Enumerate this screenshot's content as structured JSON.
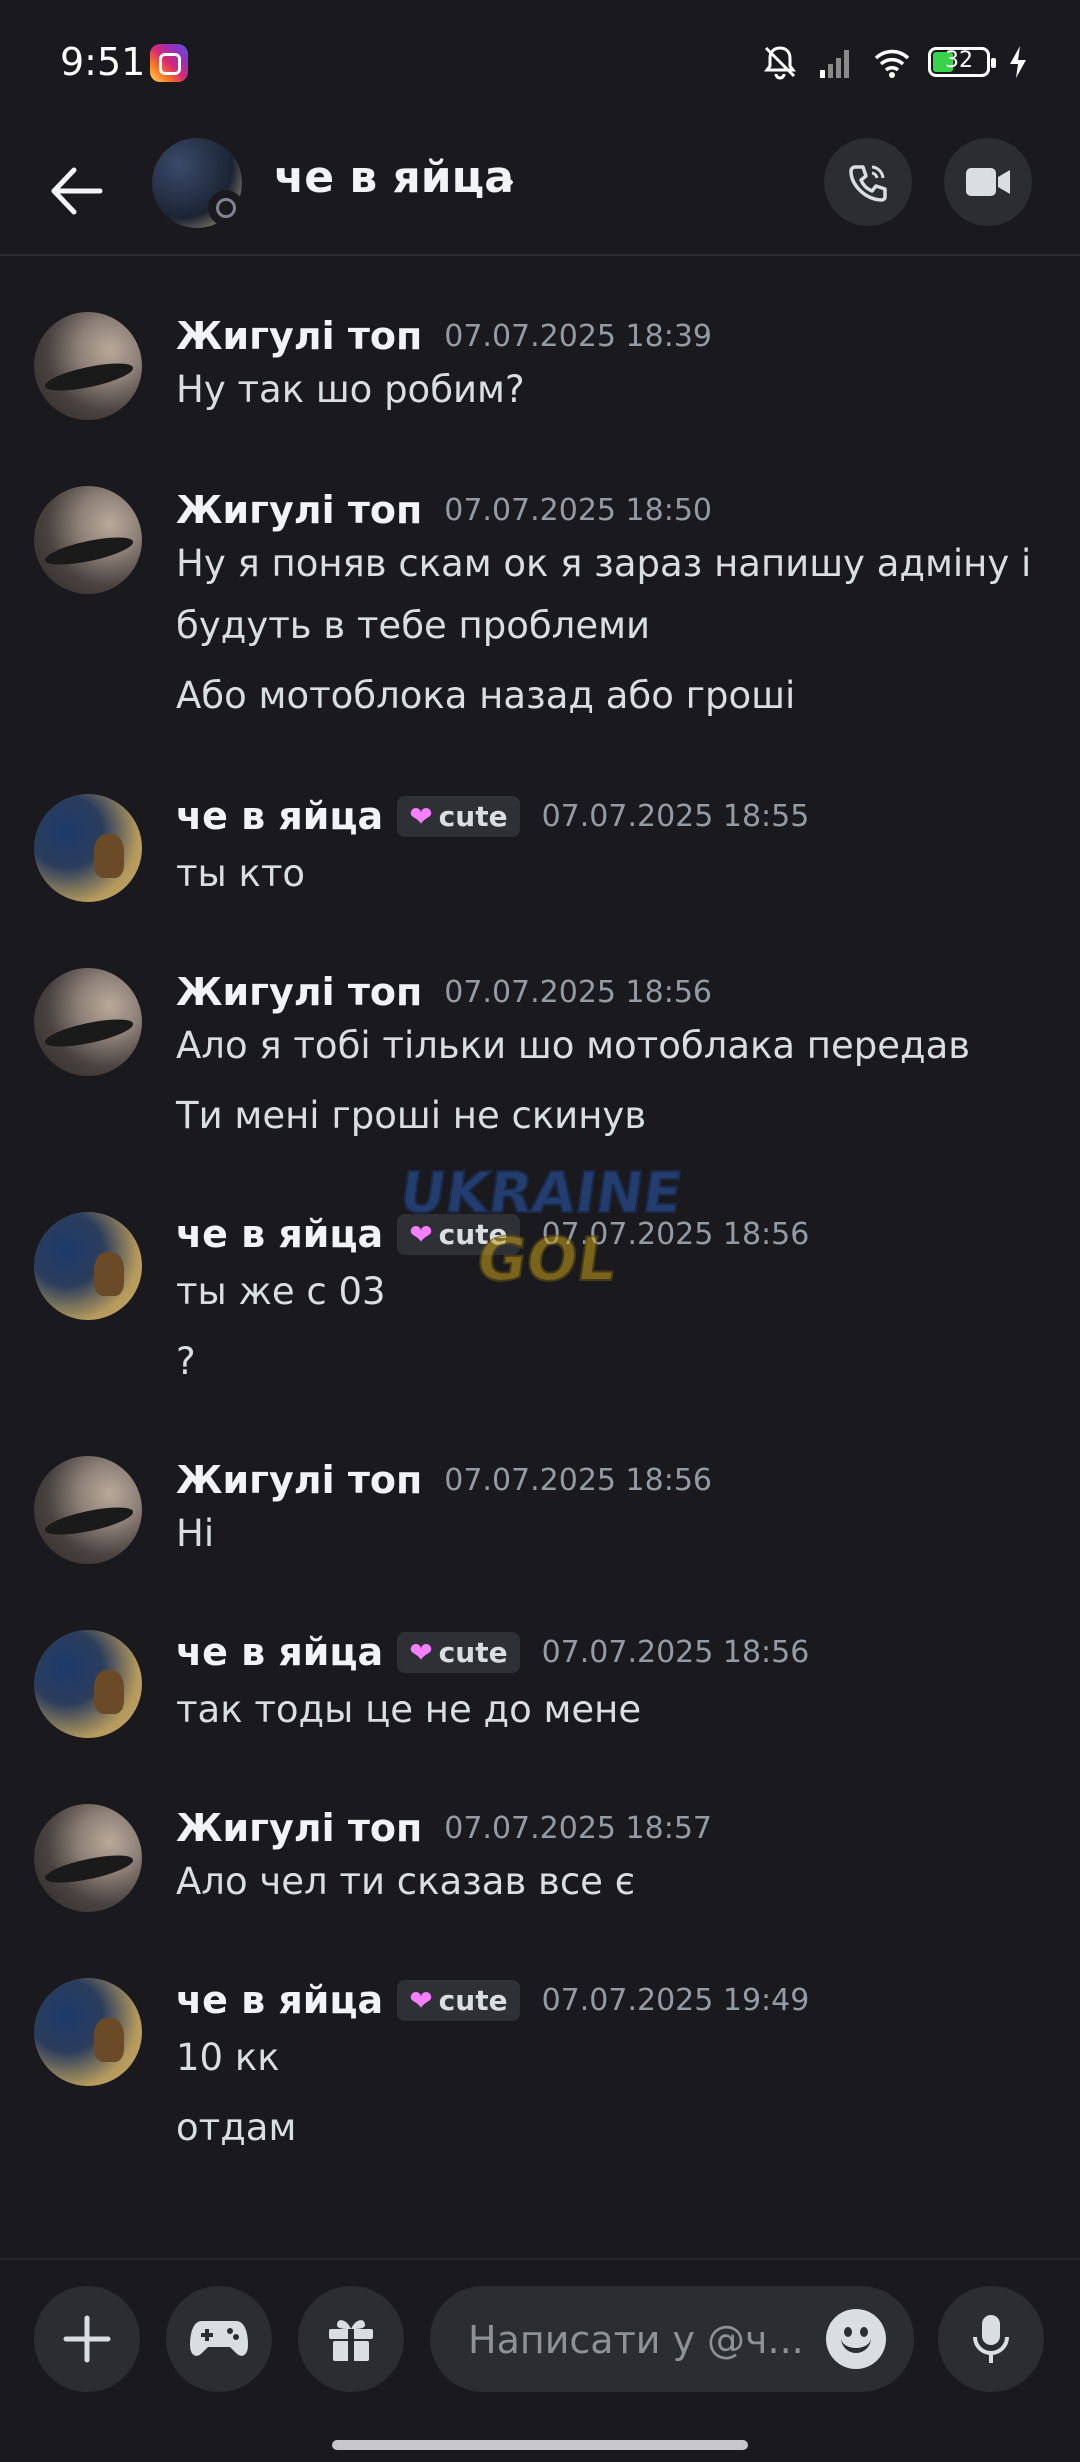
{
  "status_bar": {
    "time": "9:51",
    "battery": "32",
    "icons": [
      "instagram-icon",
      "mute-bell-icon",
      "signal-icon",
      "wifi-icon",
      "battery-icon",
      "charging-icon"
    ]
  },
  "header": {
    "title": "че в яйца",
    "chevron": "›",
    "icons": [
      "back-arrow-icon",
      "phone-call-icon",
      "video-camera-icon"
    ]
  },
  "messages": [
    {
      "author": "Жигулі топ",
      "tag": "",
      "time": "07.07.2025 18:39",
      "lines": [
        "Ну так шо робим?"
      ]
    },
    {
      "author": "Жигулі топ",
      "tag": "",
      "time": "07.07.2025 18:50",
      "lines": [
        "Ну я поняв скам ок я зараз напишу адміну і",
        "будуть в тебе проблеми",
        "Або мотоблока назад або гроші"
      ]
    },
    {
      "author": "че в яйца",
      "tag": "cute",
      "time": "07.07.2025 18:55",
      "lines": [
        "ты кто"
      ]
    },
    {
      "author": "Жигулі топ",
      "tag": "",
      "time": "07.07.2025 18:56",
      "lines": [
        "Ало я тобі тільки шо мотоблака передав",
        "Ти мені гроші не скинув"
      ]
    },
    {
      "author": "че в яйца",
      "tag": "cute",
      "time": "07.07.2025 18:56",
      "lines": [
        "ты же с 03",
        "?"
      ]
    },
    {
      "author": "Жигулі топ",
      "tag": "",
      "time": "07.07.2025 18:56",
      "lines": [
        "Ні"
      ]
    },
    {
      "author": "че в яйца",
      "tag": "cute",
      "time": "07.07.2025 18:56",
      "lines": [
        "так тоды це не до мене"
      ]
    },
    {
      "author": "Жигулі топ",
      "tag": "",
      "time": "07.07.2025 18:57",
      "lines": [
        "Ало чел ти сказав все є"
      ]
    },
    {
      "author": "че в яйца",
      "tag": "cute",
      "time": "07.07.2025 19:49",
      "lines": [
        "10 кк",
        "отдам"
      ]
    }
  ],
  "watermark": {
    "line1": "UKRAINE",
    "line2": "GOL"
  },
  "composer": {
    "placeholder": "Написати у @ч...",
    "icons": [
      "plus-icon",
      "gamepad-icon",
      "gift-icon",
      "emoji-icon",
      "microphone-icon"
    ]
  },
  "colors": {
    "background": "#1a1a1e",
    "tag_heart": "#f47fff",
    "battery_fill": "#3ad14d"
  }
}
